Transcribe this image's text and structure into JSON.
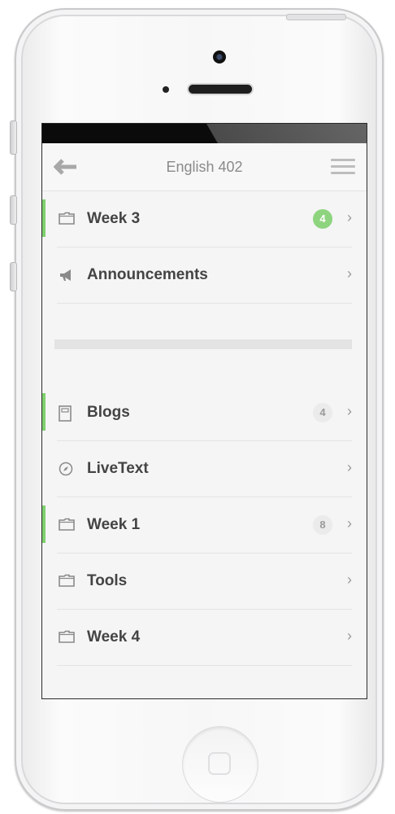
{
  "app": {
    "title": "English 402"
  },
  "icons": {
    "back": "back-arrow-icon",
    "menu": "hamburger-menu-icon",
    "folder": "folder-icon",
    "megaphone": "megaphone-icon",
    "notebook": "notebook-icon",
    "compass": "compass-icon",
    "chevron": "chevron-right-icon"
  },
  "colors": {
    "accent": "#7ed06e",
    "badge_green": "#8ed47f",
    "badge_gray": "#ebebeb"
  },
  "group1": [
    {
      "label": "Week 3",
      "icon": "folder-icon",
      "badge": "4",
      "badge_style": "green",
      "highlighted": true,
      "chevron": "›"
    },
    {
      "label": "Announcements",
      "icon": "megaphone-icon",
      "badge": null,
      "highlighted": false,
      "chevron": "›"
    }
  ],
  "group2": [
    {
      "label": "Blogs",
      "icon": "notebook-icon",
      "badge": "4",
      "badge_style": "gray",
      "highlighted": true,
      "chevron": "›"
    },
    {
      "label": "LiveText",
      "icon": "compass-icon",
      "badge": null,
      "highlighted": false,
      "chevron": "›"
    },
    {
      "label": "Week 1",
      "icon": "folder-icon",
      "badge": "8",
      "badge_style": "gray",
      "highlighted": true,
      "chevron": "›"
    },
    {
      "label": "Tools",
      "icon": "folder-icon",
      "badge": null,
      "highlighted": false,
      "chevron": "›"
    },
    {
      "label": "Week 4",
      "icon": "folder-icon",
      "badge": null,
      "highlighted": false,
      "chevron": "›"
    }
  ]
}
